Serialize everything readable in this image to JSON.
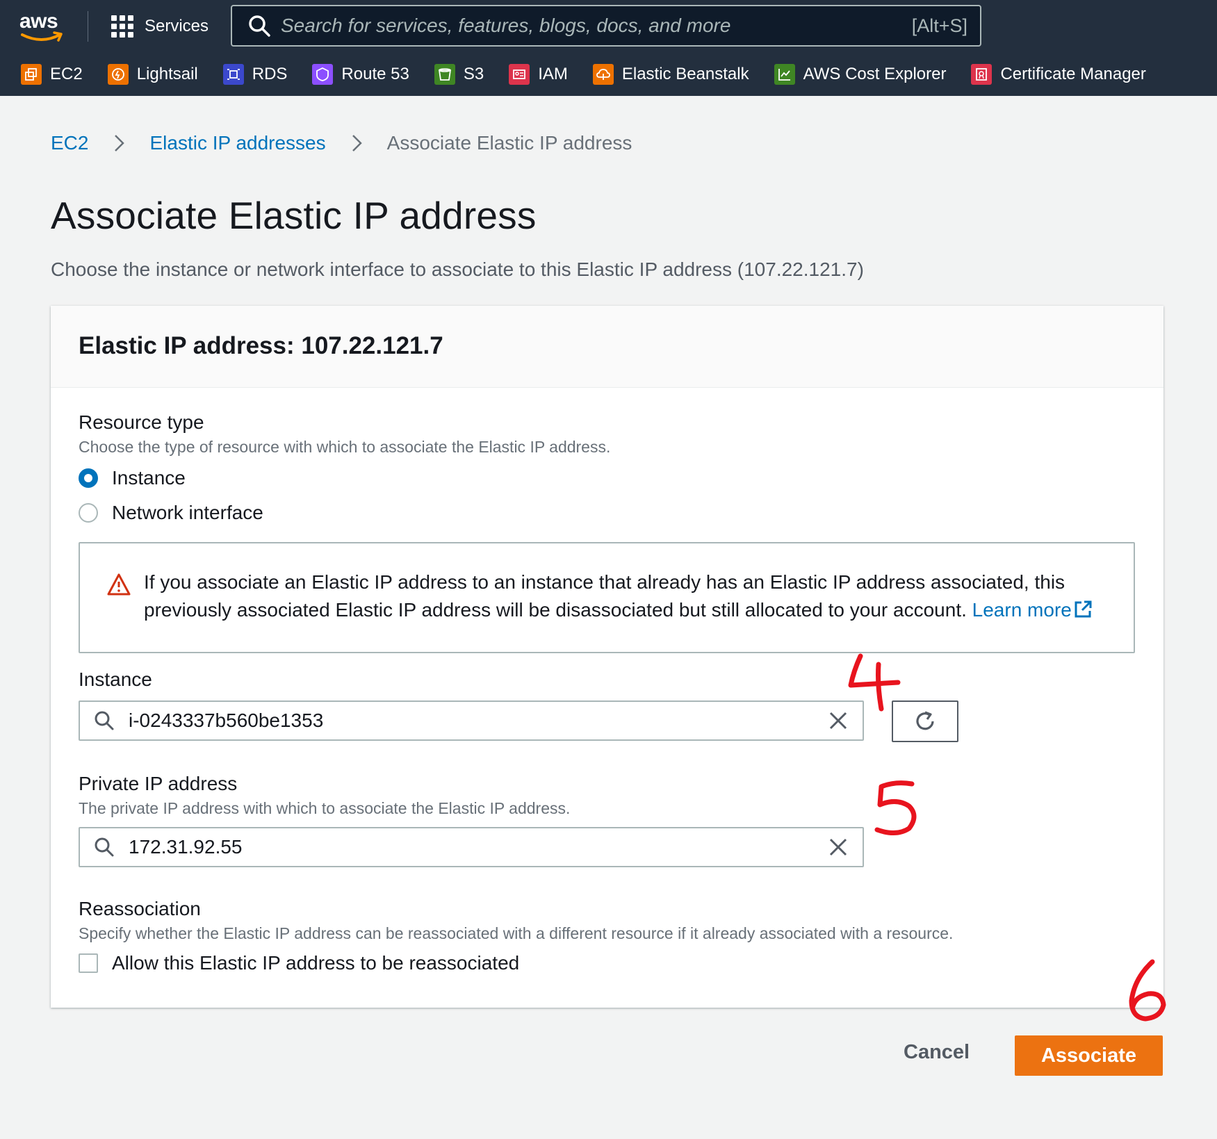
{
  "topbar": {
    "logo_text": "aws",
    "services_label": "Services",
    "search_placeholder": "Search for services, features, blogs, docs, and more",
    "search_shortcut": "[Alt+S]",
    "favorites": [
      {
        "label": "EC2",
        "icon": "ec2-icon",
        "color": "#ed7100"
      },
      {
        "label": "Lightsail",
        "icon": "lightsail-icon",
        "color": "#ed7100"
      },
      {
        "label": "RDS",
        "icon": "rds-icon",
        "color": "#3b48cc"
      },
      {
        "label": "Route 53",
        "icon": "route53-icon",
        "color": "#8c4fff"
      },
      {
        "label": "S3",
        "icon": "s3-icon",
        "color": "#3f8624"
      },
      {
        "label": "IAM",
        "icon": "iam-icon",
        "color": "#dd344c"
      },
      {
        "label": "Elastic Beanstalk",
        "icon": "elastic-beanstalk-icon",
        "color": "#ed7100"
      },
      {
        "label": "AWS Cost Explorer",
        "icon": "cost-explorer-icon",
        "color": "#3f8624"
      },
      {
        "label": "Certificate Manager",
        "icon": "certificate-manager-icon",
        "color": "#dd344c"
      }
    ]
  },
  "breadcrumb": {
    "items": [
      "EC2",
      "Elastic IP addresses"
    ],
    "current": "Associate Elastic IP address"
  },
  "page": {
    "title": "Associate Elastic IP address",
    "description": "Choose the instance or network interface to associate to this Elastic IP address (107.22.121.7)"
  },
  "panel": {
    "title": "Elastic IP address: 107.22.121.7",
    "resource_type": {
      "label": "Resource type",
      "description": "Choose the type of resource with which to associate the Elastic IP address.",
      "options": [
        "Instance",
        "Network interface"
      ],
      "selected": "Instance"
    },
    "alert": {
      "text": "If you associate an Elastic IP address to an instance that already has an Elastic IP address associated, this previously associated Elastic IP address will be disassociated but still allocated to your account.",
      "link": "Learn more"
    },
    "instance": {
      "label": "Instance",
      "value": "i-0243337b560be1353"
    },
    "private_ip": {
      "label": "Private IP address",
      "description": "The private IP address with which to associate the Elastic IP address.",
      "value": "172.31.92.55"
    },
    "reassociation": {
      "label": "Reassociation",
      "description": "Specify whether the Elastic IP address can be reassociated with a different resource if it already associated with a resource.",
      "checkbox_label": "Allow this Elastic IP address to be reassociated",
      "checked": false
    }
  },
  "actions": {
    "cancel": "Cancel",
    "associate": "Associate"
  },
  "annotations": [
    "4",
    "5",
    "6"
  ],
  "colors": {
    "nav_bg": "#232f3e",
    "link": "#0073bb",
    "primary_button": "#ec7211",
    "annotation": "#e8141e"
  }
}
